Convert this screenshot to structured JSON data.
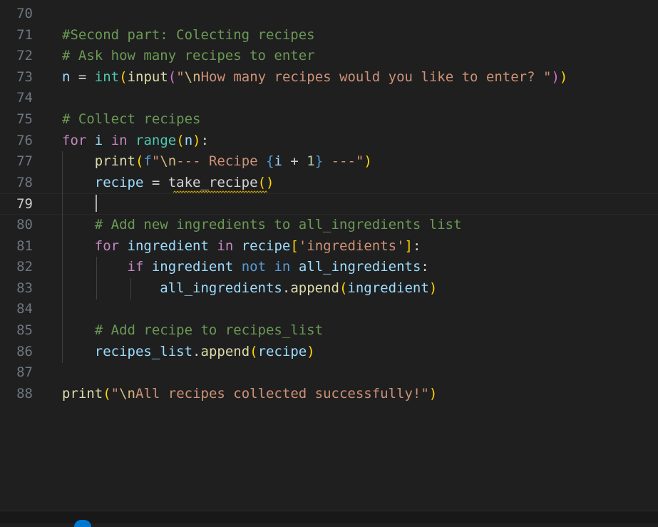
{
  "editor": {
    "lines": [
      {
        "n": "70",
        "tokens": []
      },
      {
        "n": "71",
        "tokens": [
          {
            "c": "cm",
            "t": "#Second part: Colecting recipes"
          }
        ]
      },
      {
        "n": "72",
        "tokens": [
          {
            "c": "cm",
            "t": "# Ask how many recipes to enter"
          }
        ]
      },
      {
        "n": "73",
        "tokens": [
          {
            "c": "vr",
            "t": "n"
          },
          {
            "c": "op",
            "t": " = "
          },
          {
            "c": "bi",
            "t": "int"
          },
          {
            "c": "b1",
            "t": "("
          },
          {
            "c": "fn",
            "t": "input"
          },
          {
            "c": "b2",
            "t": "("
          },
          {
            "c": "st",
            "t": "\""
          },
          {
            "c": "es",
            "t": "\\n"
          },
          {
            "c": "st",
            "t": "How many recipes would you like to enter? \""
          },
          {
            "c": "b2",
            "t": ")"
          },
          {
            "c": "b1",
            "t": ")"
          }
        ]
      },
      {
        "n": "74",
        "tokens": []
      },
      {
        "n": "75",
        "tokens": [
          {
            "c": "cm",
            "t": "# Collect recipes"
          }
        ]
      },
      {
        "n": "76",
        "tokens": [
          {
            "c": "kw",
            "t": "for"
          },
          {
            "c": "op",
            "t": " "
          },
          {
            "c": "vr",
            "t": "i"
          },
          {
            "c": "op",
            "t": " "
          },
          {
            "c": "kw",
            "t": "in"
          },
          {
            "c": "op",
            "t": " "
          },
          {
            "c": "bi",
            "t": "range"
          },
          {
            "c": "b1",
            "t": "("
          },
          {
            "c": "vr",
            "t": "n"
          },
          {
            "c": "b1",
            "t": ")"
          },
          {
            "c": "op",
            "t": ":"
          }
        ]
      },
      {
        "n": "77",
        "tokens": [
          {
            "c": "op",
            "t": "    "
          },
          {
            "c": "fn",
            "t": "print"
          },
          {
            "c": "b1",
            "t": "("
          },
          {
            "c": "kb",
            "t": "f"
          },
          {
            "c": "st",
            "t": "\""
          },
          {
            "c": "es",
            "t": "\\n"
          },
          {
            "c": "st",
            "t": "--- Recipe "
          },
          {
            "c": "kb",
            "t": "{"
          },
          {
            "c": "vr",
            "t": "i"
          },
          {
            "c": "op",
            "t": " + "
          },
          {
            "c": "nm",
            "t": "1"
          },
          {
            "c": "kb",
            "t": "}"
          },
          {
            "c": "st",
            "t": " ---\""
          },
          {
            "c": "b1",
            "t": ")"
          }
        ]
      },
      {
        "n": "78",
        "tokens": [
          {
            "c": "op",
            "t": "    "
          },
          {
            "c": "vr",
            "t": "recipe"
          },
          {
            "c": "op",
            "t": " = "
          },
          {
            "c": "op",
            "t": "take_recipe"
          },
          {
            "c": "b1",
            "t": "("
          },
          {
            "c": "b1",
            "t": ")"
          }
        ]
      },
      {
        "n": "79",
        "tokens": []
      },
      {
        "n": "80",
        "tokens": [
          {
            "c": "op",
            "t": "    "
          },
          {
            "c": "cm",
            "t": "# Add new ingredients to all_ingredients list"
          }
        ]
      },
      {
        "n": "81",
        "tokens": [
          {
            "c": "op",
            "t": "    "
          },
          {
            "c": "kw",
            "t": "for"
          },
          {
            "c": "op",
            "t": " "
          },
          {
            "c": "vr",
            "t": "ingredient"
          },
          {
            "c": "op",
            "t": " "
          },
          {
            "c": "kw",
            "t": "in"
          },
          {
            "c": "op",
            "t": " "
          },
          {
            "c": "vr",
            "t": "recipe"
          },
          {
            "c": "b1",
            "t": "["
          },
          {
            "c": "st",
            "t": "'ingredients'"
          },
          {
            "c": "b1",
            "t": "]"
          },
          {
            "c": "op",
            "t": ":"
          }
        ]
      },
      {
        "n": "82",
        "tokens": [
          {
            "c": "op",
            "t": "        "
          },
          {
            "c": "kw",
            "t": "if"
          },
          {
            "c": "op",
            "t": " "
          },
          {
            "c": "vr",
            "t": "ingredient"
          },
          {
            "c": "op",
            "t": " "
          },
          {
            "c": "kb",
            "t": "not"
          },
          {
            "c": "op",
            "t": " "
          },
          {
            "c": "kb",
            "t": "in"
          },
          {
            "c": "op",
            "t": " "
          },
          {
            "c": "vr",
            "t": "all_ingredients"
          },
          {
            "c": "op",
            "t": ":"
          }
        ]
      },
      {
        "n": "83",
        "tokens": [
          {
            "c": "op",
            "t": "            "
          },
          {
            "c": "vr",
            "t": "all_ingredients"
          },
          {
            "c": "op",
            "t": "."
          },
          {
            "c": "fn",
            "t": "append"
          },
          {
            "c": "b1",
            "t": "("
          },
          {
            "c": "vr",
            "t": "ingredient"
          },
          {
            "c": "b1",
            "t": ")"
          }
        ]
      },
      {
        "n": "84",
        "tokens": []
      },
      {
        "n": "85",
        "tokens": [
          {
            "c": "op",
            "t": "    "
          },
          {
            "c": "cm",
            "t": "# Add recipe to recipes_list"
          }
        ]
      },
      {
        "n": "86",
        "tokens": [
          {
            "c": "op",
            "t": "    "
          },
          {
            "c": "vr",
            "t": "recipes_list"
          },
          {
            "c": "op",
            "t": "."
          },
          {
            "c": "fn",
            "t": "append"
          },
          {
            "c": "b1",
            "t": "("
          },
          {
            "c": "vr",
            "t": "recipe"
          },
          {
            "c": "b1",
            "t": ")"
          }
        ]
      },
      {
        "n": "87",
        "tokens": []
      },
      {
        "n": "88",
        "tokens": [
          {
            "c": "fn",
            "t": "print"
          },
          {
            "c": "b1",
            "t": "("
          },
          {
            "c": "st",
            "t": "\""
          },
          {
            "c": "es",
            "t": "\\n"
          },
          {
            "c": "st",
            "t": "All recipes collected successfully!\""
          },
          {
            "c": "b1",
            "t": ")"
          }
        ]
      }
    ],
    "current_line": "79",
    "cursor_line": "79",
    "squiggle_word": "take_recipe",
    "squiggle_color": "#cca700"
  },
  "colors": {
    "background": "#1f1f1f",
    "line_number": "#6e7681",
    "active_line_number": "#cccccc"
  }
}
